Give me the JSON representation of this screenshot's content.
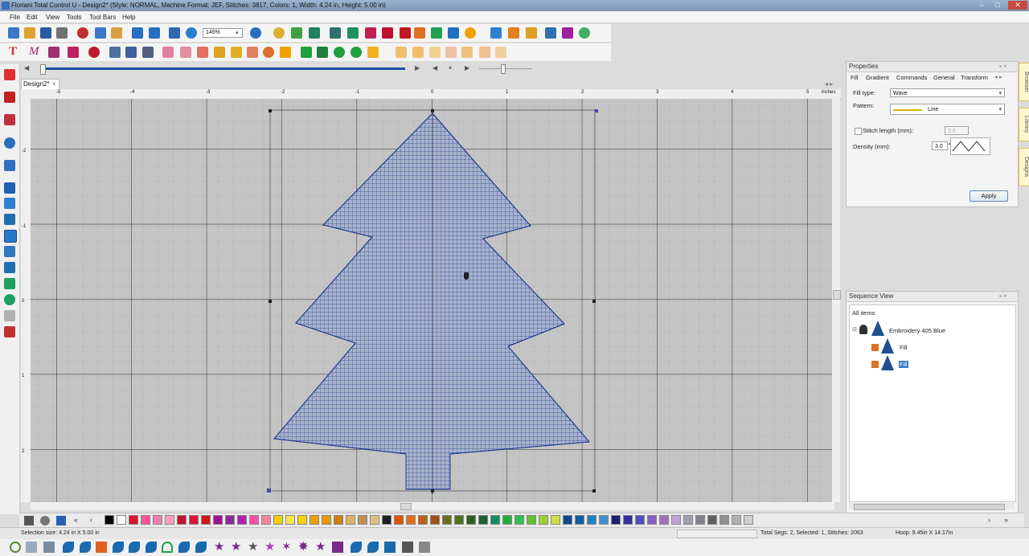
{
  "window": {
    "title": "Floriani Total Control U - Design2* (Style: NORMAL, Machine Format: JEF, Stitches: 3817, Colors: 1, Width: 4.24 in, Height: 5.00 in)",
    "minimize_label": "–",
    "maximize_label": "□",
    "close_label": "✕"
  },
  "menu": [
    "File",
    "Edit",
    "View",
    "Tools",
    "Tool Bars",
    "Help"
  ],
  "toolbar": {
    "zoom_value": "146%",
    "zoom_arrow": "▾"
  },
  "playback": {
    "prev": "◀",
    "play": "▶",
    "pause": "⏸",
    "next": "▶"
  },
  "document": {
    "tab_label": "Design2*",
    "tab_close": "×"
  },
  "ruler": {
    "top_labels": [
      "-5",
      "-4",
      "-3",
      "-2",
      "-1",
      "0",
      "1",
      "2",
      "3",
      "4",
      "5"
    ],
    "unit": "inches",
    "left_labels": [
      "-2",
      "-1",
      "0",
      "1",
      "2"
    ]
  },
  "properties": {
    "title": "Properties",
    "tabs": [
      "Fill",
      "Gradient",
      "Commands",
      "General",
      "Transform"
    ],
    "fill_type_label": "Fill type:",
    "fill_type_value": "Wave",
    "pattern_label": "Pattern:",
    "pattern_value": "Line",
    "stitch_length_label": "Stitch length (mm):",
    "stitch_length_value": "3.5",
    "density_label": "Density (mm):",
    "density_value": "3.0",
    "apply_label": "Apply"
  },
  "side_tabs": [
    "Browser",
    "Library",
    "Designs"
  ],
  "sequence": {
    "title": "Sequence View",
    "all_items_label": "All items",
    "group_label": "Embroidery 405 Blue",
    "items": [
      "Fill",
      "Fill"
    ]
  },
  "status": {
    "selection_size": "Selection size: 4.24 in X 5.00 in",
    "total_segs": "Total Segs: 2, Selected: 1, Stitches: 2063",
    "hoop": "Hoop: 9.45in X 14.17in"
  },
  "palette_colors": [
    "#000000",
    "#ffffff",
    "#e0102a",
    "#ff4f9a",
    "#f080b0",
    "#ff9cc0",
    "#c8102e",
    "#e0103c",
    "#d01818",
    "#a01090",
    "#8a2b98",
    "#b020b0",
    "#ff50a0",
    "#ff80a0",
    "#f0d000",
    "#ffe650",
    "#ffd000",
    "#f0a000",
    "#e89800",
    "#d08000",
    "#e0b060",
    "#c09050",
    "#e0c080",
    "#202020",
    "#e05000",
    "#e07010",
    "#c06010",
    "#a05010",
    "#6a7018",
    "#507020",
    "#306018",
    "#206030",
    "#109060",
    "#20b040",
    "#30c050",
    "#60c030",
    "#a0d030",
    "#d0e040",
    "#104890",
    "#1060a0",
    "#2080c0",
    "#4090d0",
    "#202070",
    "#3030a0",
    "#5050c0",
    "#8060c0",
    "#a070c0",
    "#c0a0e0",
    "#a0a0b0",
    "#808090",
    "#606060",
    "#909090",
    "#b0b0b0",
    "#d0d0d0"
  ],
  "accent": {
    "stitch_blue": "#1a3a8c",
    "tree_fill": "#a9b2cc",
    "canvas_bg": "#c4c4c4",
    "scroll_blue": "#1a4fa0"
  }
}
